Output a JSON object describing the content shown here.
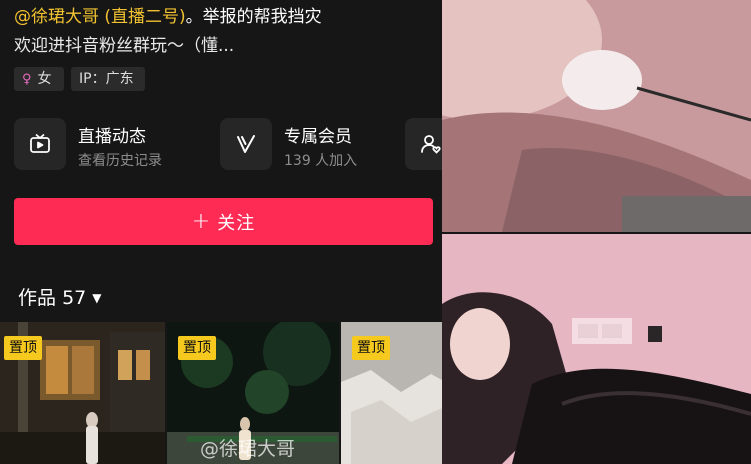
{
  "bio": {
    "mention": "@徐珺大哥 (直播二号)",
    "line1_rest": "。举报的帮我挡灾",
    "line2": "欢迎进抖音粉丝群玩～（懂..."
  },
  "tags": {
    "gender_icon": "♀",
    "gender": "女",
    "ip": "IP：广东"
  },
  "features": [
    {
      "title": "直播动态",
      "subtitle": "查看历史记录",
      "icon": "tv-icon"
    },
    {
      "title": "专属会员",
      "subtitle": "139 人加入",
      "icon": "v-badge-icon"
    },
    {
      "title": "",
      "subtitle": "",
      "icon": "user-heart-icon"
    }
  ],
  "follow_button": {
    "plus": "+",
    "label": "关注"
  },
  "works": {
    "label": "作品",
    "count": "57",
    "dropdown": "▼"
  },
  "thumbnails": [
    {
      "pin": "置顶"
    },
    {
      "pin": "置顶"
    },
    {
      "pin": "置顶"
    }
  ],
  "watermark": "@徐珺大哥",
  "colors": {
    "accent": "#fe2c55",
    "mention": "#f2c230",
    "pin": "#f6c91e"
  }
}
